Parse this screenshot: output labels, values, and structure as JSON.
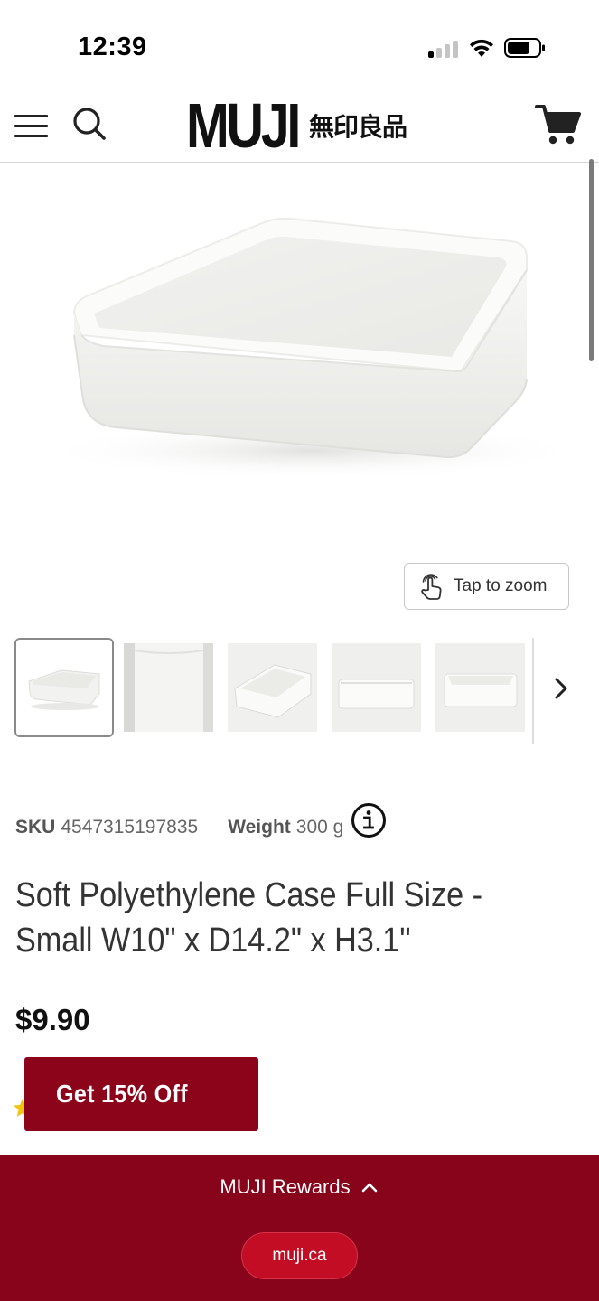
{
  "status_bar": {
    "time": "12:39",
    "signal_icon": "cellular-signal-icon",
    "wifi_icon": "wifi-icon",
    "battery_icon": "battery-icon"
  },
  "header": {
    "menu_icon": "hamburger-menu-icon",
    "search_icon": "search-icon",
    "logo_latin": "MUJI",
    "logo_kanji": "無印良品",
    "cart_icon": "shopping-cart-icon"
  },
  "gallery": {
    "zoom_label": "Tap to zoom",
    "zoom_icon": "tap-hand-icon",
    "next_icon": "chevron-right-icon",
    "thumbnail_count": 5,
    "active_thumbnail": 0
  },
  "product": {
    "sku_label": "SKU",
    "sku_value": "4547315197835",
    "weight_label": "Weight",
    "weight_value": "300 g",
    "info_icon": "info-icon",
    "title_line1": "Soft Polyethylene Case Full Size -",
    "title_line2": "Small W10\" x D14.2\" x H3.1\"",
    "price": "$9.90"
  },
  "offer": {
    "label": "Get 15% Off"
  },
  "rewards": {
    "label": "MUJI Rewards",
    "chevron_icon": "chevron-up-icon",
    "domain": "muji.ca"
  },
  "colors": {
    "brand_red": "#87041a",
    "offer_red": "#8b0419",
    "pill_red": "#c20d25",
    "text_dark": "#333333"
  }
}
